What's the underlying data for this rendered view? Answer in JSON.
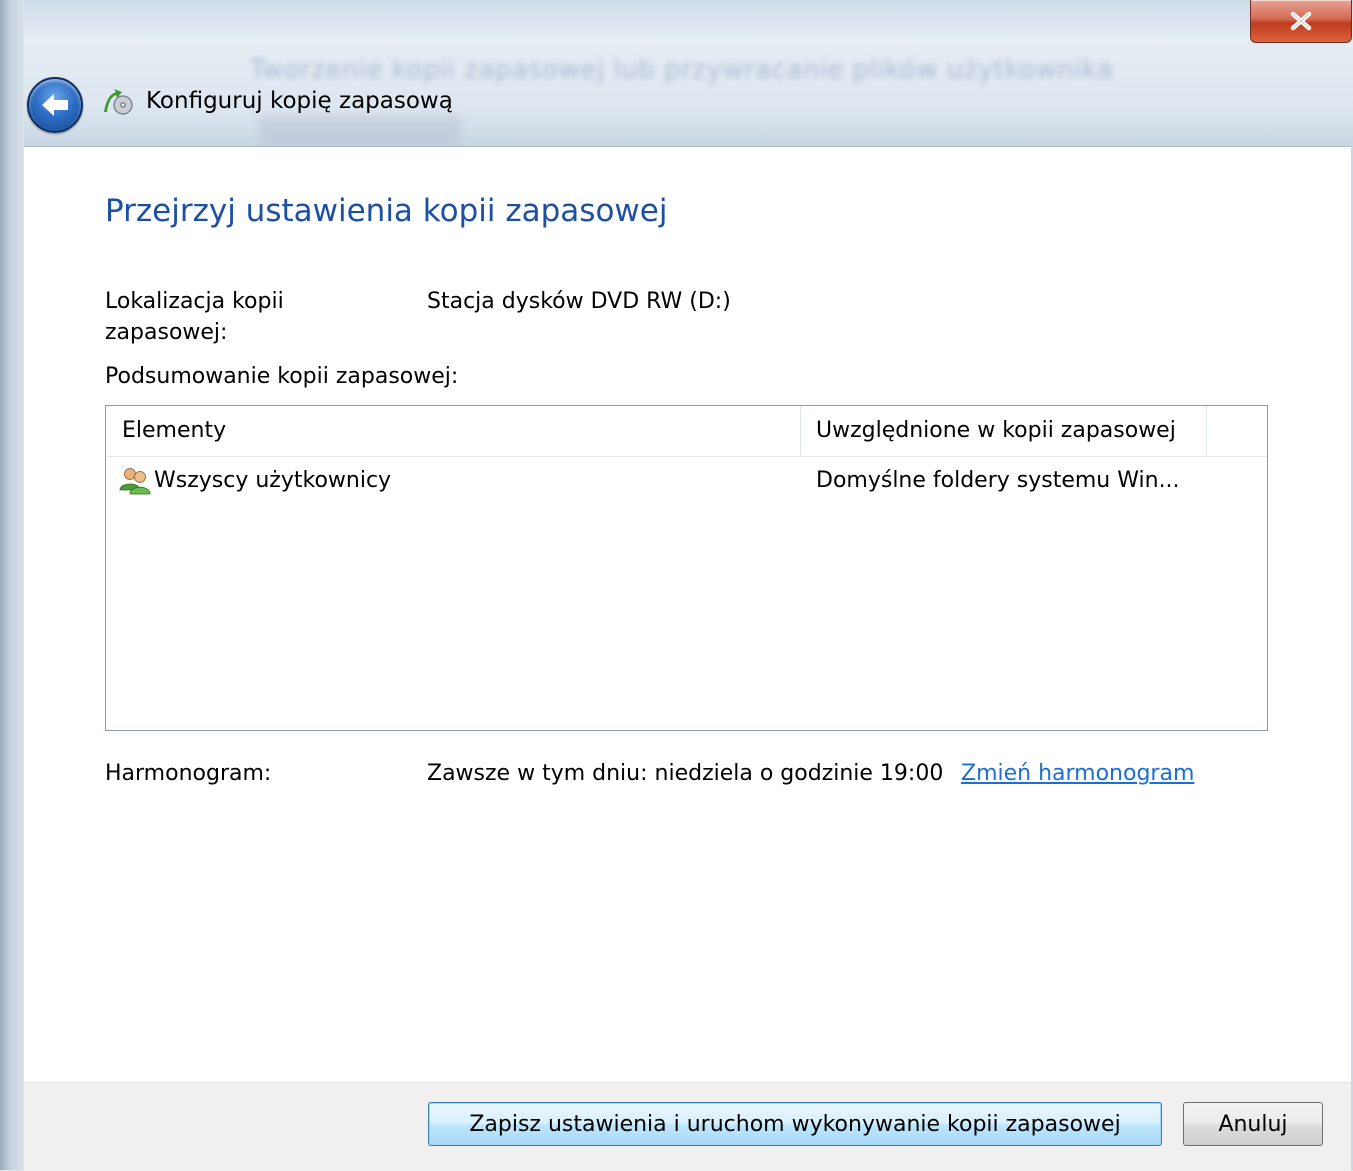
{
  "window": {
    "title": "Konfiguruj kopię zapasową",
    "background_blur_text": "Tworzenie kopii zapasowej lub przywracanie plików użytkownika",
    "back_icon": "back-arrow-icon",
    "close_icon": "close-x-icon",
    "title_icon": "backup-icon"
  },
  "page": {
    "heading": "Przejrzyj ustawienia kopii zapasowej",
    "location_label": "Lokalizacja kopii zapasowej:",
    "location_value": "Stacja dysków DVD RW (D:)",
    "summary_label": "Podsumowanie kopii zapasowej:",
    "schedule_label": "Harmonogram:",
    "schedule_value": "Zawsze w tym dniu: niedziela o godzinie 19:00",
    "schedule_link": "Zmień harmonogram"
  },
  "table": {
    "columns": [
      "Elementy",
      "Uwzględnione w kopii zapasowej"
    ],
    "rows": [
      {
        "item": "Wszyscy użytkownicy",
        "included": "Domyślne foldery systemu Win...",
        "icon": "users-icon"
      }
    ]
  },
  "buttons": {
    "save": "Zapisz ustawienia i uruchom wykonywanie kopii zapasowej",
    "cancel": "Anuluj"
  },
  "colors": {
    "heading": "#1d4fa5",
    "link": "#1a6fd6",
    "close_button": "#c03b1f"
  }
}
